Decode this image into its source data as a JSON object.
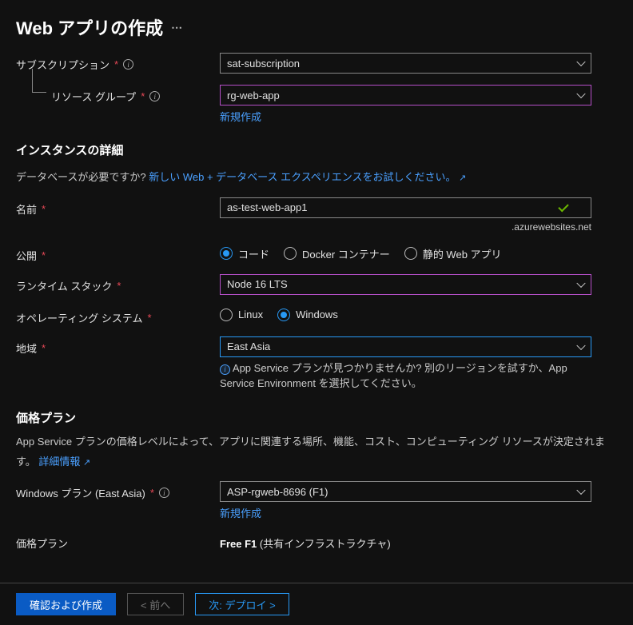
{
  "title": "Web アプリの作成",
  "subscription": {
    "label": "サブスクリプション",
    "value": "sat-subscription"
  },
  "resource_group": {
    "label": "リソース グループ",
    "value": "rg-web-app",
    "new_link": "新規作成"
  },
  "instance": {
    "heading": "インスタンスの詳細",
    "db_prompt": "データベースが必要ですか?",
    "db_link": "新しい Web + データベース エクスペリエンスをお試しください。",
    "name_label": "名前",
    "name_value": "as-test-web-app1",
    "name_suffix": ".azurewebsites.net",
    "publish_label": "公開",
    "publish_options": {
      "code": "コード",
      "docker": "Docker コンテナー",
      "static": "静的 Web アプリ"
    },
    "runtime_label": "ランタイム スタック",
    "runtime_value": "Node 16 LTS",
    "os_label": "オペレーティング システム",
    "os_options": {
      "linux": "Linux",
      "windows": "Windows"
    },
    "region_label": "地域",
    "region_value": "East Asia",
    "region_help": "App Service プランが見つかりませんか? 別のリージョンを試すか、App Service Environment を選択してください。"
  },
  "pricing": {
    "heading": "価格プラン",
    "desc_pre": "App Service プランの価格レベルによって、アプリに関連する場所、機能、コスト、コンピューティング リソースが決定されます。",
    "learn_more": "詳細情報",
    "plan_label": "Windows プラン (East Asia)",
    "plan_value": "ASP-rgweb-8696 (F1)",
    "plan_new_link": "新規作成",
    "tier_label": "価格プラン",
    "tier_bold": "Free F1",
    "tier_rest": " (共有インフラストラクチャ)"
  },
  "footer": {
    "review": "確認および作成",
    "prev": "< 前へ",
    "next": "次: デプロイ >"
  }
}
